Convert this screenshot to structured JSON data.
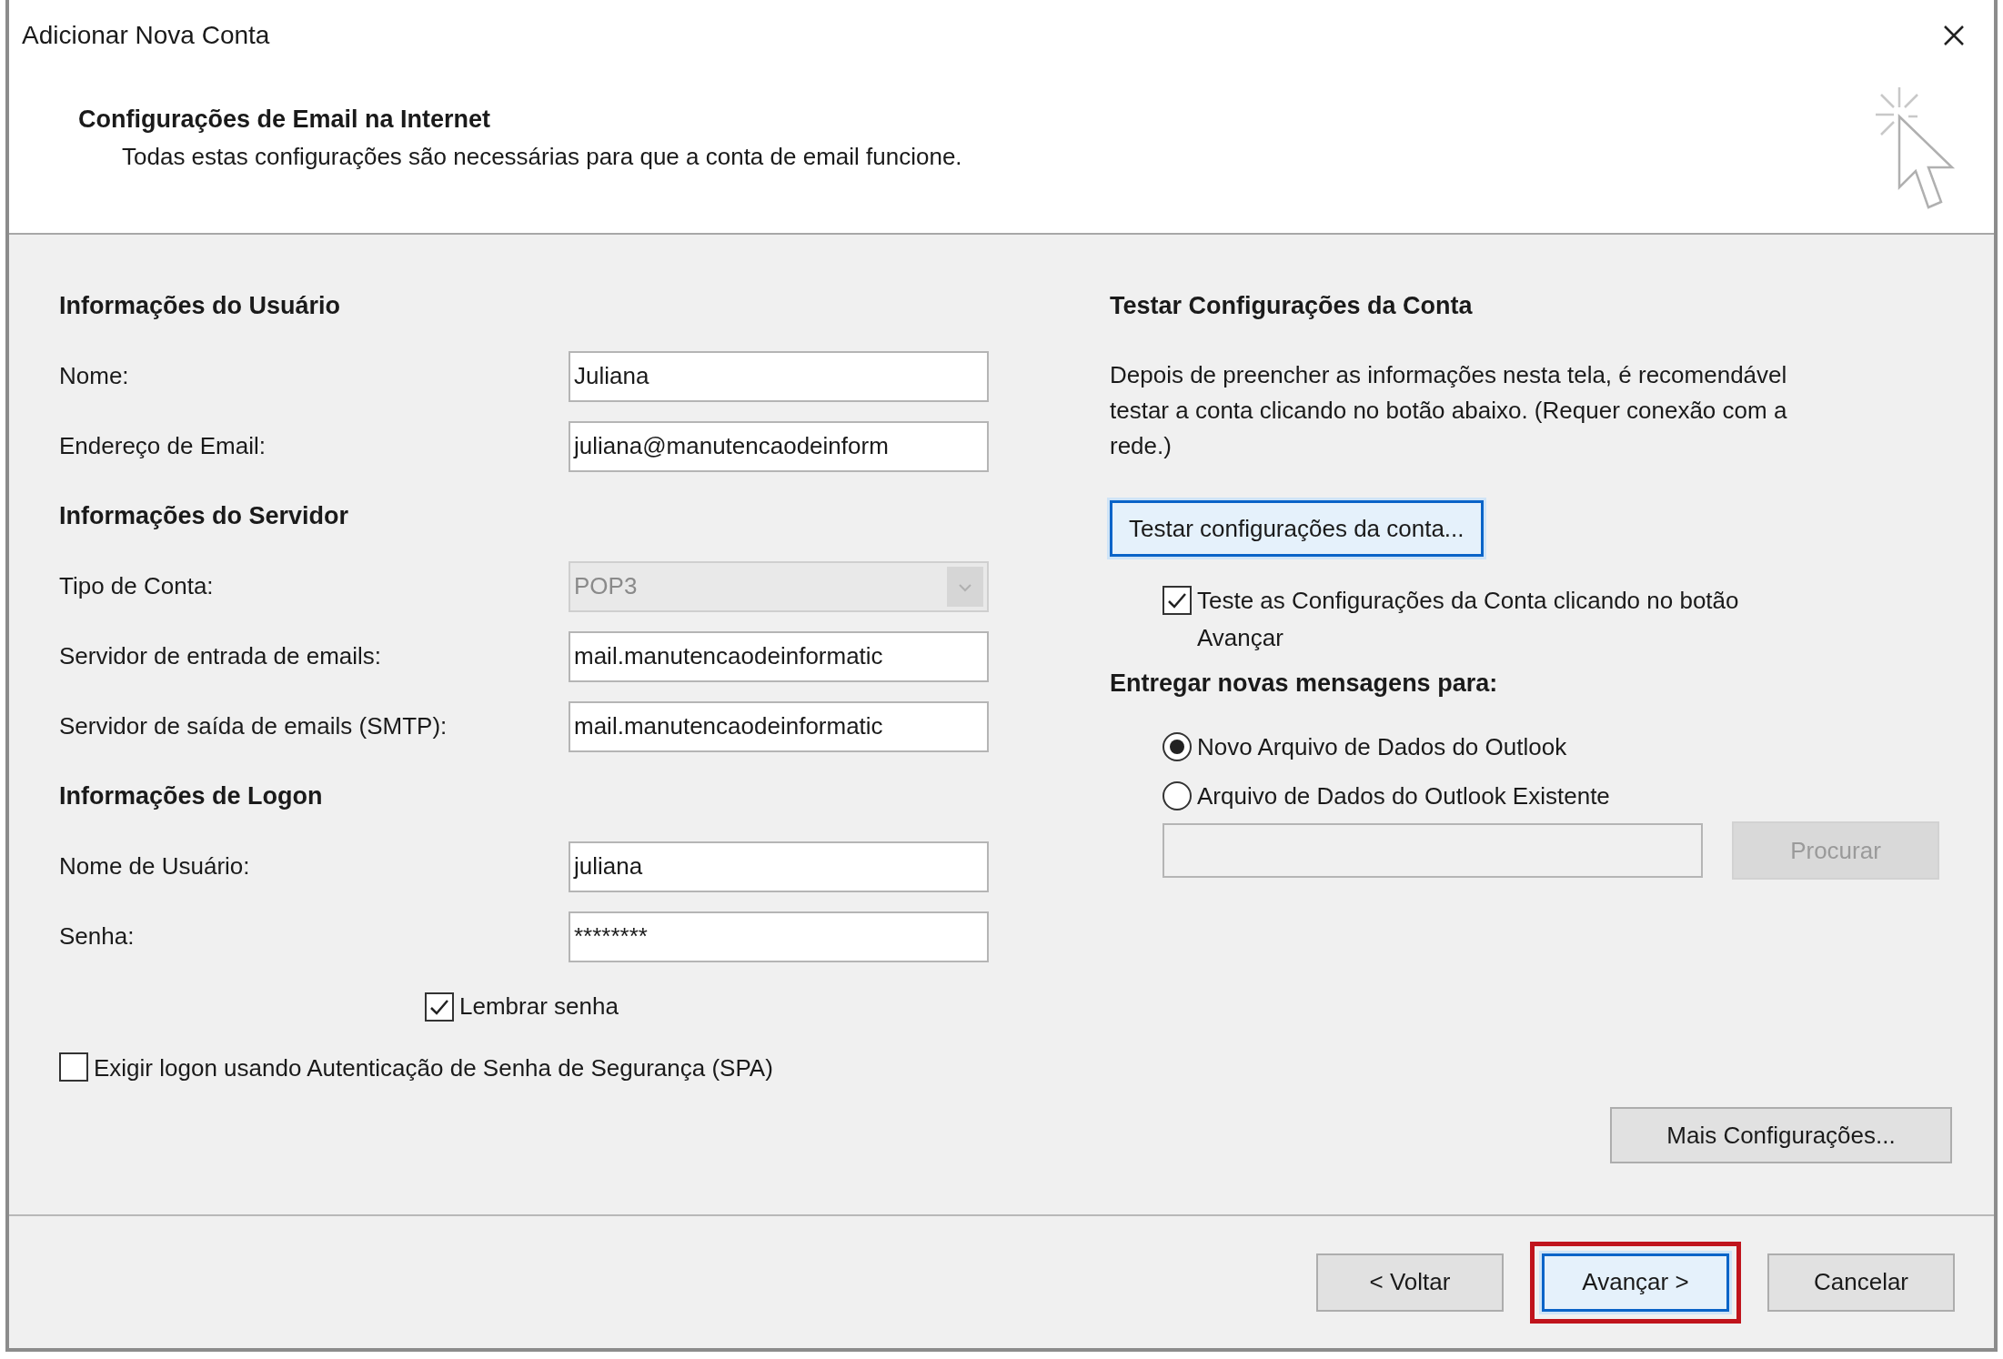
{
  "window": {
    "title": "Adicionar Nova Conta"
  },
  "header": {
    "title": "Configurações de Email na Internet",
    "subtitle": "Todas estas configurações são necessárias para que a conta de email funcione."
  },
  "sections": [
    {
      "heading": "Informações do Usuário",
      "fields": [
        {
          "label": "Nome:",
          "value": "Juliana",
          "kind": "text",
          "disabled": false
        },
        {
          "label": "Endereço de Email:",
          "value": "juliana@manutencaodeinform",
          "kind": "text",
          "disabled": false
        }
      ]
    },
    {
      "heading": "Informações do Servidor",
      "fields": [
        {
          "label": "Tipo de Conta:",
          "value": "POP3",
          "kind": "select",
          "disabled": true
        },
        {
          "label": "Servidor de entrada de emails:",
          "value": "mail.manutencaodeinformatic",
          "kind": "text",
          "disabled": false
        },
        {
          "label": "Servidor de saída de emails (SMTP):",
          "value": "mail.manutencaodeinformatic",
          "kind": "text",
          "disabled": false
        }
      ]
    },
    {
      "heading": "Informações de Logon",
      "fields": [
        {
          "label": "Nome de Usuário:",
          "value": "juliana",
          "kind": "text",
          "disabled": false
        },
        {
          "label": "Senha:",
          "value": "********",
          "kind": "password",
          "disabled": false
        }
      ]
    }
  ],
  "remember_password": {
    "label": "Lembrar senha",
    "checked": true
  },
  "spa": {
    "label": "Exigir logon usando Autenticação de Senha de Segurança (SPA)",
    "checked": false
  },
  "test": {
    "heading": "Testar Configurações da Conta",
    "description": "Depois de preencher as informações nesta tela, é recomendável testar a conta clicando no botão abaixo. (Requer conexão com a rede.)",
    "button": {
      "label": "Testar configurações da conta...",
      "focused": true
    },
    "auto_test": {
      "label": "Teste as Configurações da Conta clicando no botão Avançar",
      "checked": true
    }
  },
  "delivery": {
    "heading": "Entregar novas mensagens para:",
    "options": [
      {
        "label": "Novo Arquivo de Dados do Outlook",
        "selected": true
      },
      {
        "label": "Arquivo de Dados do Outlook Existente",
        "selected": false
      }
    ],
    "browse_button": {
      "label": "Procurar",
      "disabled": true
    }
  },
  "more_button": {
    "label": "Mais Configurações..."
  },
  "footer_buttons": [
    {
      "label": "< Voltar",
      "focused": false,
      "annotated": false
    },
    {
      "label": "Avançar >",
      "focused": true,
      "annotated": true
    },
    {
      "label": "Cancelar",
      "focused": false,
      "annotated": false
    }
  ]
}
